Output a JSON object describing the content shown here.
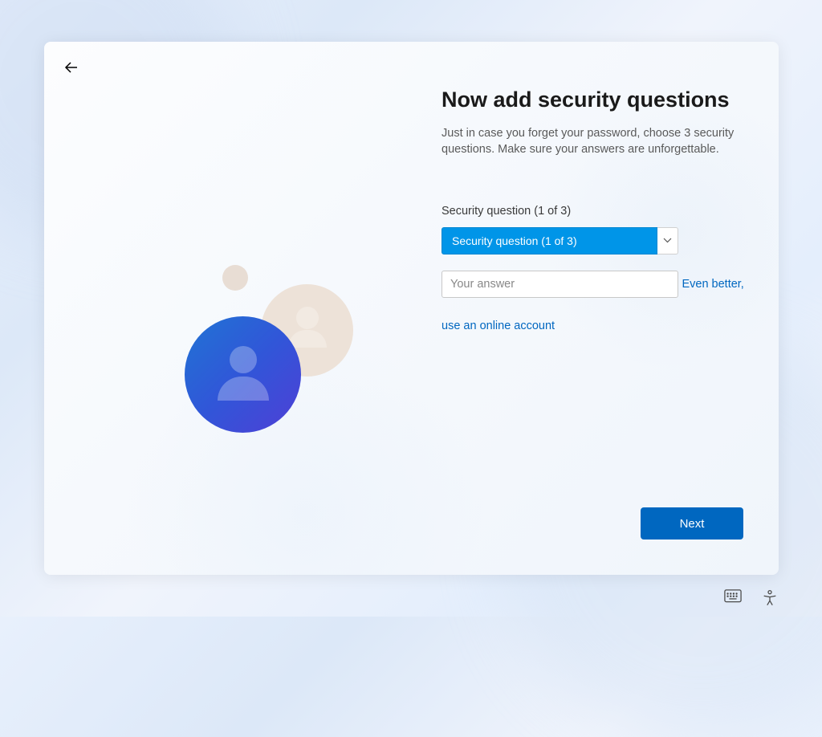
{
  "heading": "Now add security questions",
  "subtitle": "Just in case you forget your password, choose 3 security questions. Make sure your answers are unforgettable.",
  "field_label": "Security question (1 of 3)",
  "question_select": {
    "selected": "Security question (1 of 3)"
  },
  "answer": {
    "placeholder": "Your answer",
    "value": ""
  },
  "online_account_link": "Even better, use an online account",
  "next_button": "Next"
}
